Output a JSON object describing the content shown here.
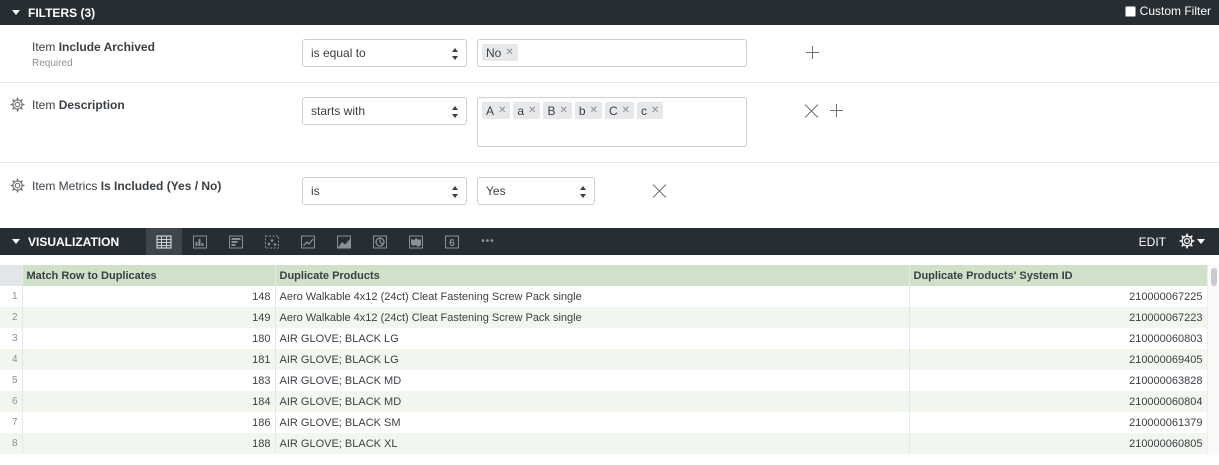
{
  "filters": {
    "title": "FILTERS (3)",
    "custom_filter_label": "Custom Filter",
    "rows": [
      {
        "label_prefix": "Item",
        "label_field": "Include Archived",
        "sublabel": "Required",
        "operator": "is equal to",
        "tags": [
          "No"
        ]
      },
      {
        "label_prefix": "Item",
        "label_field": "Description",
        "operator": "starts with",
        "tags": [
          "A",
          "a",
          "B",
          "b",
          "C",
          "c"
        ]
      },
      {
        "label_prefix": "Item Metrics",
        "label_field": "Is Included (Yes / No)",
        "operator": "is",
        "value": "Yes"
      }
    ]
  },
  "visualization": {
    "title": "VISUALIZATION",
    "edit_label": "EDIT",
    "icons": [
      "table-icon",
      "column-chart-icon",
      "bar-chart-icon",
      "scatter-icon",
      "line-chart-icon",
      "area-chart-icon",
      "pie-chart-icon",
      "map-icon",
      "single-value-icon",
      "more-icon"
    ],
    "single_value_glyph": "6",
    "more_glyph": "•••"
  },
  "table": {
    "columns": [
      "Match Row to Duplicates",
      "Duplicate Products",
      "Duplicate Products' System ID"
    ],
    "rows": [
      {
        "n": "1",
        "match": "148",
        "product": "Aero Walkable 4x12 (24ct) Cleat Fastening Screw Pack single",
        "id": "210000067225"
      },
      {
        "n": "2",
        "match": "149",
        "product": "Aero Walkable 4x12 (24ct) Cleat Fastening Screw Pack single",
        "id": "210000067223"
      },
      {
        "n": "3",
        "match": "180",
        "product": "AIR GLOVE; BLACK LG",
        "id": "210000060803"
      },
      {
        "n": "4",
        "match": "181",
        "product": "AIR GLOVE; BLACK LG",
        "id": "210000069405"
      },
      {
        "n": "5",
        "match": "183",
        "product": "AIR GLOVE; BLACK MD",
        "id": "210000063828"
      },
      {
        "n": "6",
        "match": "184",
        "product": "AIR GLOVE; BLACK MD",
        "id": "210000060804"
      },
      {
        "n": "7",
        "match": "186",
        "product": "AIR GLOVE; BLACK SM",
        "id": "210000061379"
      },
      {
        "n": "8",
        "match": "188",
        "product": "AIR GLOVE; BLACK XL",
        "id": "210000060805"
      }
    ]
  }
}
